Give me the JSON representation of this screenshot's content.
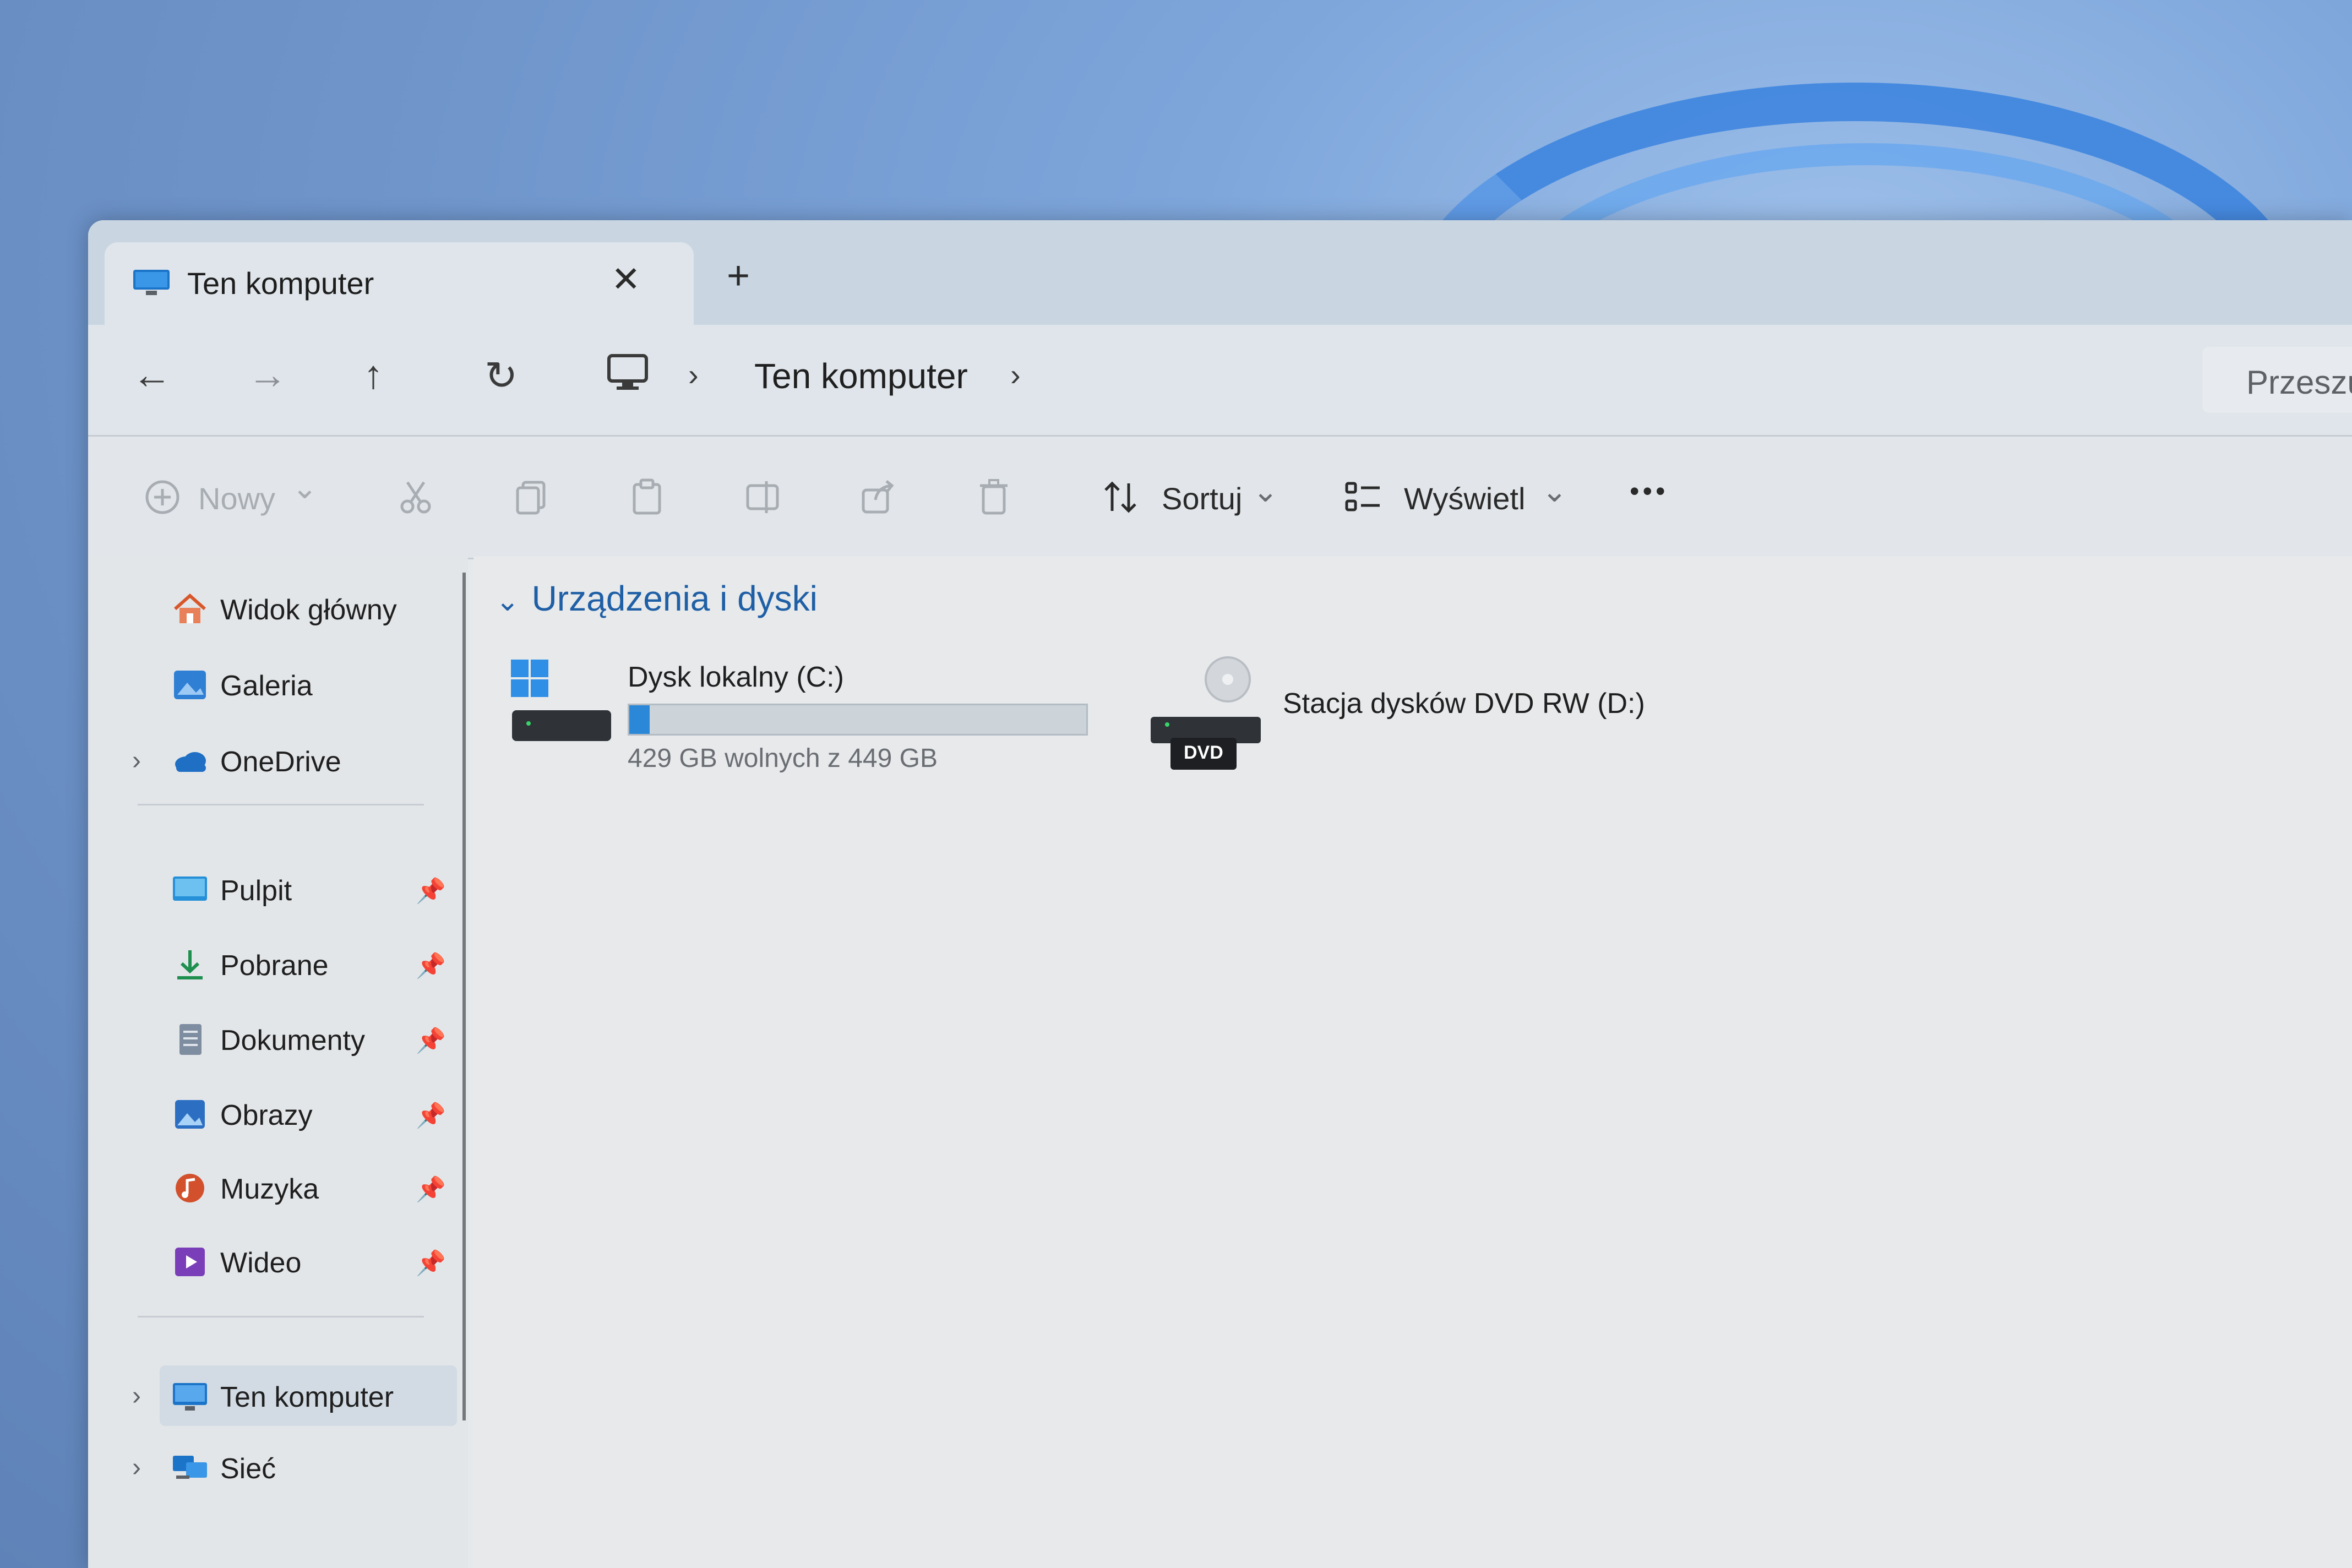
{
  "window": {
    "tab_title": "Ten komputer",
    "close_glyph": "✕",
    "new_tab_glyph": "+"
  },
  "address": {
    "back_glyph": "←",
    "forward_glyph": "→",
    "up_glyph": "↑",
    "refresh_glyph": "↻",
    "separator": "›",
    "crumb": "Ten komputer",
    "search_placeholder": "Przeszu"
  },
  "toolbar": {
    "new_label": "Nowy",
    "sort_label": "Sortuj",
    "view_label": "Wyświetl",
    "more_glyph": "•••",
    "dropdown_glyph": "⌄"
  },
  "sidebar": {
    "pin_glyph": "📌",
    "chevron_glyph": "›",
    "items": [
      {
        "label": "Widok główny",
        "icon": "home-icon"
      },
      {
        "label": "Galeria",
        "icon": "gallery-icon"
      },
      {
        "label": "OneDrive",
        "icon": "cloud-icon"
      },
      {
        "label": "Pulpit",
        "icon": "desktop-icon"
      },
      {
        "label": "Pobrane",
        "icon": "download-icon"
      },
      {
        "label": "Dokumenty",
        "icon": "document-icon"
      },
      {
        "label": "Obrazy",
        "icon": "pictures-icon"
      },
      {
        "label": "Muzyka",
        "icon": "music-icon"
      },
      {
        "label": "Wideo",
        "icon": "video-icon"
      },
      {
        "label": "Ten komputer",
        "icon": "computer-icon"
      },
      {
        "label": "Sieć",
        "icon": "network-icon"
      }
    ]
  },
  "content": {
    "section_title": "Urządzenia i dyski",
    "section_chevron": "⌄",
    "drives": [
      {
        "name": "Dysk lokalny (C:)",
        "free_text": "429 GB wolnych z 449 GB",
        "used_fraction": 0.045
      },
      {
        "name": "Stacja dysków DVD RW (D:)",
        "badge": "DVD"
      }
    ]
  },
  "colors": {
    "accent": "#2b88d8",
    "section_heading": "#1f5fa5"
  }
}
